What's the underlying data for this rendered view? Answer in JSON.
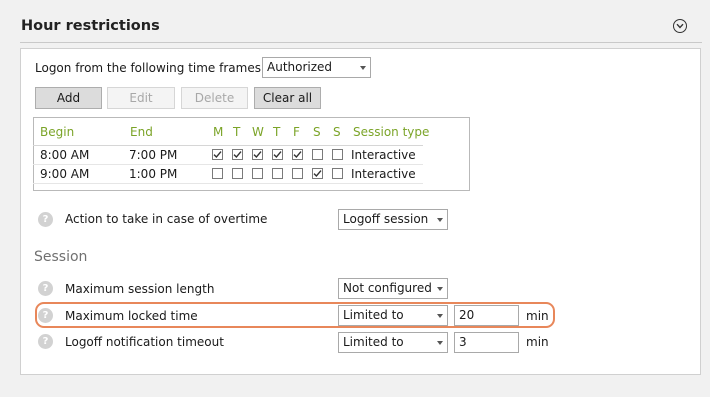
{
  "header": {
    "title": "Hour restrictions",
    "collapse_icon": "chevron-down-circle-icon"
  },
  "timeframe": {
    "label": "Logon from the following time frames are",
    "value": "Authorized"
  },
  "toolbar": {
    "add": "Add",
    "edit": "Edit",
    "delete": "Delete",
    "clear_all": "Clear all"
  },
  "grid": {
    "columns": {
      "begin": "Begin",
      "end": "End",
      "days": [
        "M",
        "T",
        "W",
        "T",
        "F",
        "S",
        "S"
      ],
      "type": "Session type"
    },
    "rows": [
      {
        "begin": "8:00 AM",
        "end": "7:00 PM",
        "days": [
          true,
          true,
          true,
          true,
          true,
          false,
          false
        ],
        "type": "Interactive"
      },
      {
        "begin": "9:00 AM",
        "end": "1:00 PM",
        "days": [
          false,
          false,
          false,
          false,
          false,
          true,
          false
        ],
        "type": "Interactive"
      }
    ],
    "header_color": "#7ba428"
  },
  "overtime": {
    "label": "Action to take in case of overtime",
    "value": "Logoff session"
  },
  "session": {
    "title": "Session",
    "max_length": {
      "label": "Maximum session length",
      "value": "Not configured"
    },
    "max_locked": {
      "label": "Maximum locked time",
      "value": "Limited to",
      "amount": "20",
      "unit": "min"
    },
    "logoff_timeout": {
      "label": "Logoff notification timeout",
      "value": "Limited to",
      "amount": "3",
      "unit": "min"
    }
  },
  "highlight_color": "#e8875a"
}
